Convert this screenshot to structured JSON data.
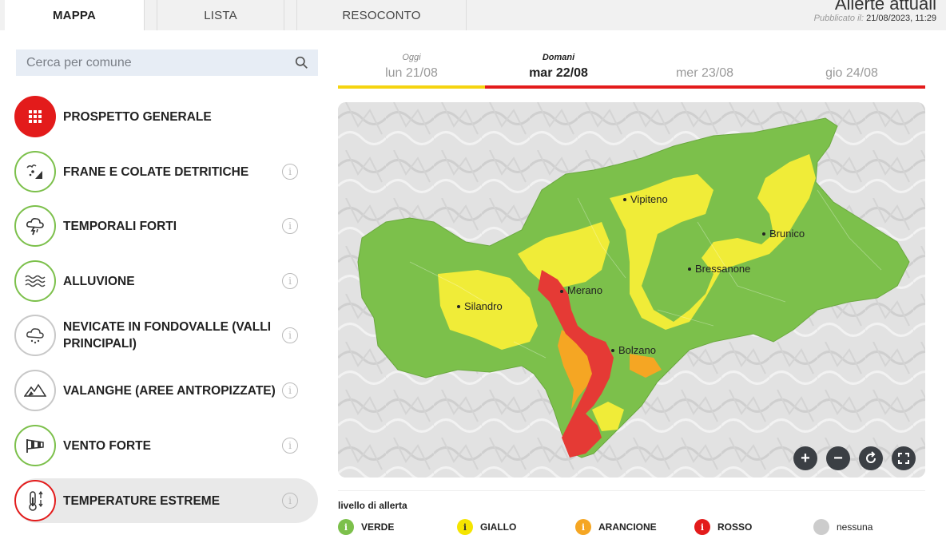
{
  "tabs": [
    "MAPPA",
    "LISTA",
    "RESOCONTO"
  ],
  "header": {
    "title": "Allerte attuali",
    "published_label": "Pubblicato il:",
    "published_value": "21/08/2023, 11:29"
  },
  "search": {
    "placeholder": "Cerca per comune",
    "icon": "search-icon"
  },
  "categories": [
    {
      "label": "PROSPETTO GENERALE",
      "icon": "grid-icon"
    },
    {
      "label": "FRANE E COLATE DETRITICHE",
      "icon": "landslide-icon"
    },
    {
      "label": "TEMPORALI FORTI",
      "icon": "thunderstorm-icon"
    },
    {
      "label": "ALLUVIONE",
      "icon": "flood-icon"
    },
    {
      "label": "NEVICATE IN FONDOVALLE (VALLI PRINCIPALI)",
      "icon": "snowfall-icon"
    },
    {
      "label": "VALANGHE (AREE ANTROPIZZATE)",
      "icon": "avalanche-icon"
    },
    {
      "label": "VENTO FORTE",
      "icon": "windsock-icon"
    },
    {
      "label": "TEMPERATURE ESTREME",
      "icon": "thermometer-icon"
    }
  ],
  "days": [
    {
      "sub": "Oggi",
      "date": "lun 21/08",
      "level_color": "#f5d40f"
    },
    {
      "sub": "Domani",
      "date": "mar 22/08",
      "level_color": "#e31b1b"
    },
    {
      "sub": "",
      "date": "mer 23/08",
      "level_color": "#e31b1b"
    },
    {
      "sub": "",
      "date": "gio 24/08",
      "level_color": "#e31b1b"
    }
  ],
  "map": {
    "places": [
      "Vipiteno",
      "Brunico",
      "Bressanone",
      "Merano",
      "Silandro",
      "Bolzano"
    ],
    "controls": [
      "zoom-in-icon",
      "zoom-out-icon",
      "reset-icon",
      "fullscreen-icon"
    ]
  },
  "legend": {
    "title": "livello di allerta",
    "items": [
      {
        "label": "VERDE",
        "color": "#7cc04b"
      },
      {
        "label": "GIALLO",
        "color": "#f5e500"
      },
      {
        "label": "ARANCIONE",
        "color": "#f5a623"
      },
      {
        "label": "ROSSO",
        "color": "#e31b1b"
      },
      {
        "label": "nessuna",
        "color": "#cccccc"
      }
    ]
  }
}
